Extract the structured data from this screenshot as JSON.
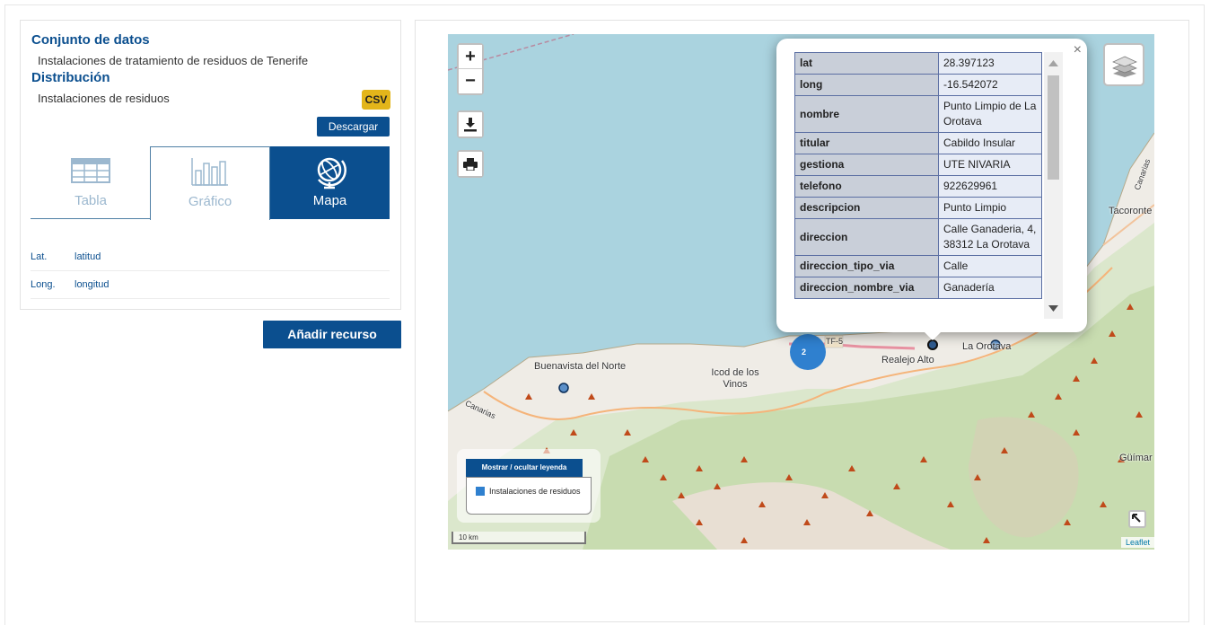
{
  "left_panel": {
    "dataset_heading": "Conjunto de datos",
    "dataset_name": "Instalaciones de tratamiento de residuos de Tenerife",
    "distribution_heading": "Distribución",
    "distribution_name": "Instalaciones de residuos",
    "format_badge": "CSV",
    "download_label": "Descargar",
    "tabs": [
      {
        "label": "Tabla",
        "icon": "table-icon",
        "active": false
      },
      {
        "label": "Gráfico",
        "icon": "bar-chart-icon",
        "active": false
      },
      {
        "label": "Mapa",
        "icon": "globe-icon",
        "active": true
      }
    ],
    "fields": [
      {
        "key": "Lat.",
        "value": "latitud"
      },
      {
        "key": "Long.",
        "value": "longitud"
      }
    ],
    "add_resource_label": "Añadir recurso"
  },
  "map": {
    "controls": {
      "zoom_in": "+",
      "zoom_out": "−"
    },
    "places": [
      "Buenavista del Norte",
      "Icod de los Vinos",
      "Realejo Alto",
      "La Orotava",
      "Tacoronte",
      "Güímar",
      "Canarias",
      "Canarias",
      "TF-5"
    ],
    "cluster_count": "2",
    "popup": {
      "close": "×",
      "rows": [
        {
          "k": "lat",
          "v": "28.397123"
        },
        {
          "k": "long",
          "v": "-16.542072"
        },
        {
          "k": "nombre",
          "v": "Punto Limpio de La Orotava"
        },
        {
          "k": "titular",
          "v": "Cabildo Insular"
        },
        {
          "k": "gestiona",
          "v": "UTE NIVARIA"
        },
        {
          "k": "telefono",
          "v": "922629961"
        },
        {
          "k": "descripcion",
          "v": "Punto Limpio"
        },
        {
          "k": "direccion",
          "v": "Calle Ganaderia, 4, 38312 La Orotava"
        },
        {
          "k": "direccion_tipo_via",
          "v": "Calle"
        },
        {
          "k": "direccion_nombre_via",
          "v": "Ganadería"
        }
      ]
    },
    "legend": {
      "toggle_label": "Mostrar / ocultar leyenda",
      "item_label": "Instalaciones de residuos",
      "item_color": "#2f80cf"
    },
    "scale_label": "10 km",
    "attribution": "Leaflet"
  }
}
